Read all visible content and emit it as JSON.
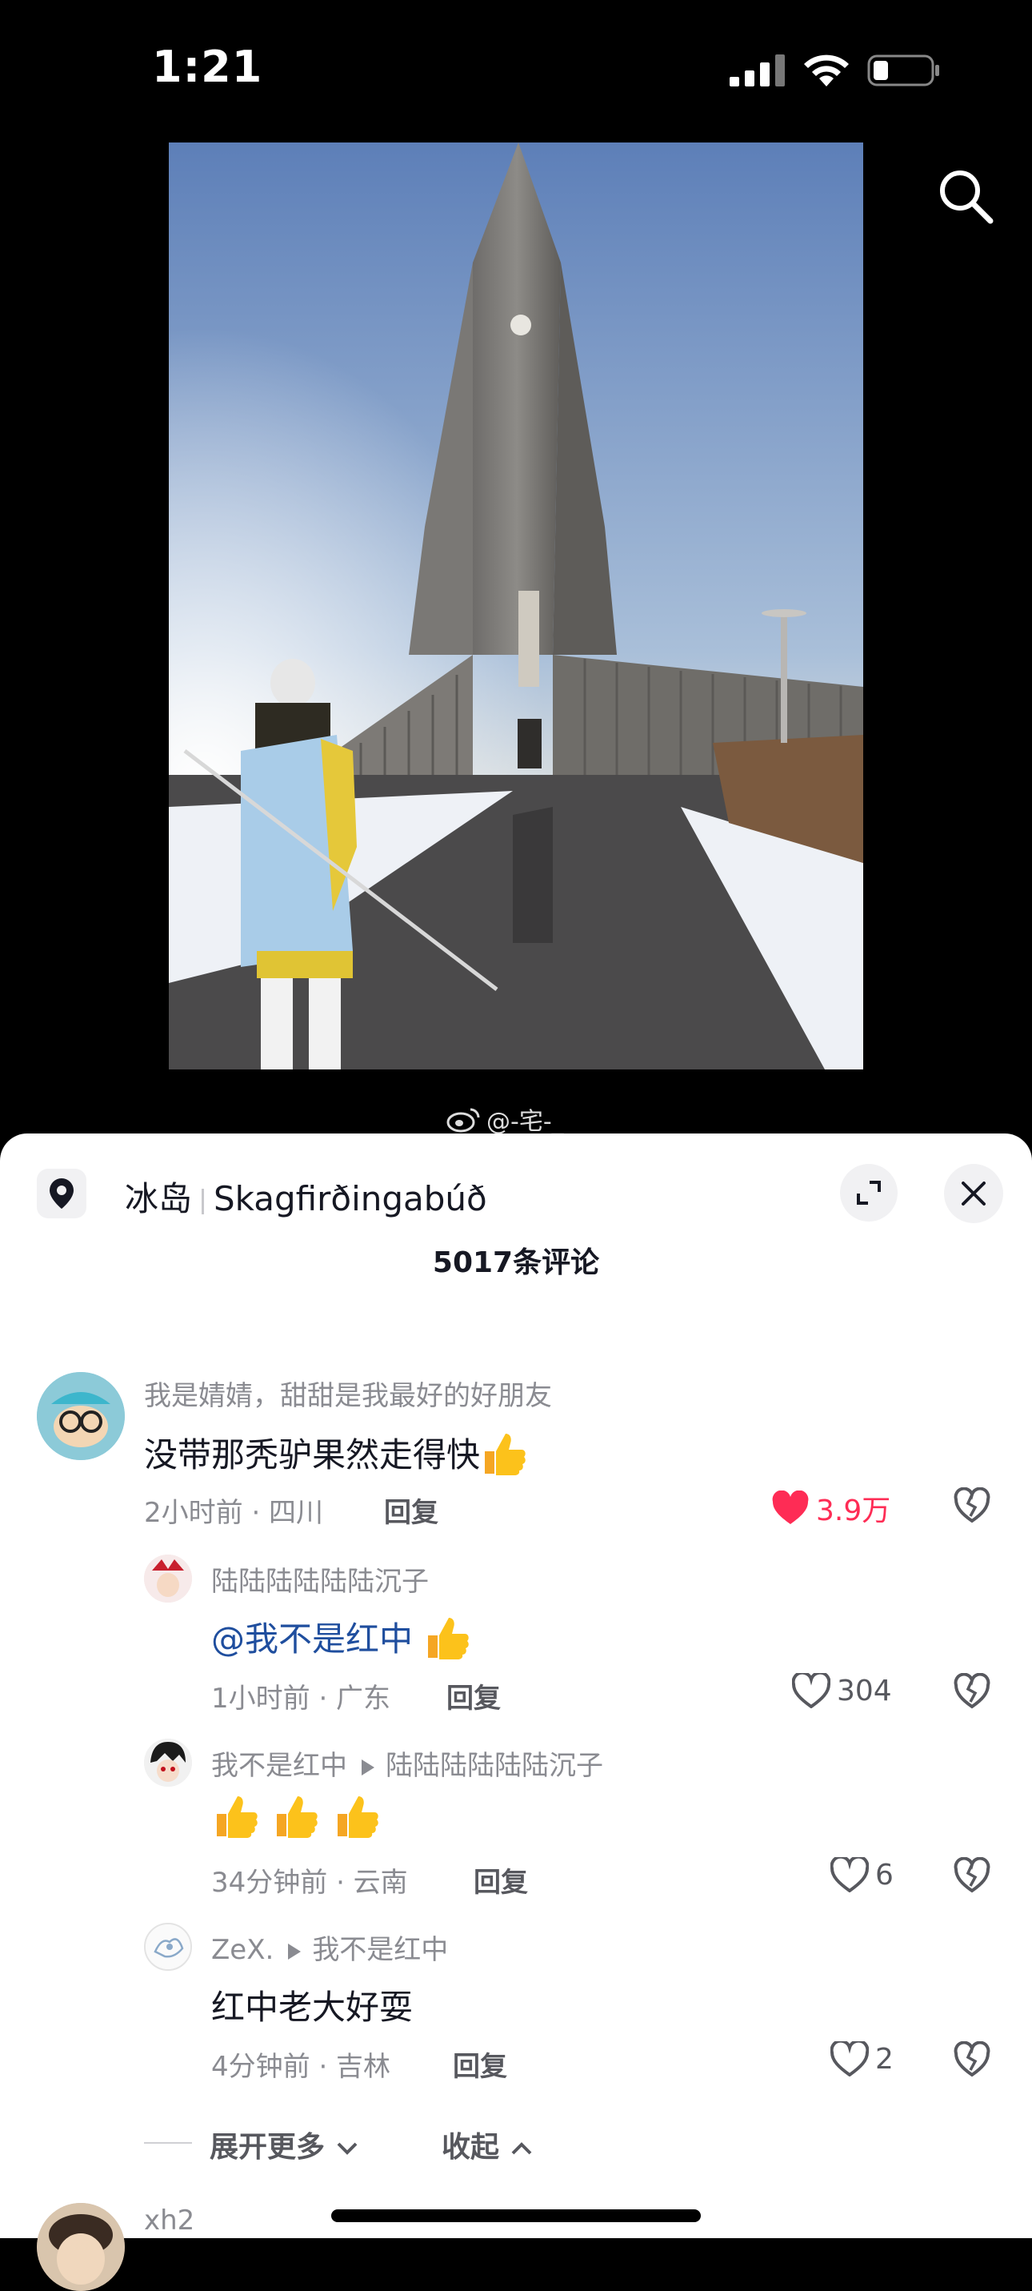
{
  "status_bar": {
    "time": "1:21"
  },
  "watermark": {
    "text": "@-宅-_"
  },
  "location": {
    "region": "冰岛",
    "place": "Skagfirðingabúð"
  },
  "comments_title": "5017条评论",
  "comments": [
    {
      "user": "我是婧婧，甜甜是我最好的好朋友",
      "text": "没带那秃驴果然走得快",
      "meta": "2小时前 · 四川",
      "reply": "回复",
      "likes": "3.9万",
      "liked": true
    },
    {
      "user": "陆陆陆陆陆陆沉子",
      "text": "@我不是红中",
      "meta": "1小时前 · 广东",
      "reply": "回复",
      "likes": "304",
      "liked": false
    },
    {
      "user": "我不是红中",
      "reply_to": "陆陆陆陆陆陆沉子",
      "text": "",
      "meta": "34分钟前 · 云南",
      "reply": "回复",
      "likes": "6",
      "liked": false
    },
    {
      "user": "ZeX.",
      "reply_to": "我不是红中",
      "text": "红中老大好耍",
      "meta": "4分钟前 · 吉林",
      "reply": "回复",
      "likes": "2",
      "liked": false
    },
    {
      "user": "xh2"
    }
  ],
  "replies_controls": {
    "expand": "展开更多",
    "collapse": "收起"
  },
  "icons": {
    "search": "search-icon",
    "location": "location-pin-icon",
    "expand": "expand-icon",
    "close": "close-icon",
    "like": "heart-icon",
    "dislike": "broken-heart-icon",
    "thumbs": "thumbs-up-emoji"
  },
  "colors": {
    "like_active": "#fe2c55",
    "mention": "#1f4e9e",
    "sheet_bg": "#ffffff"
  }
}
